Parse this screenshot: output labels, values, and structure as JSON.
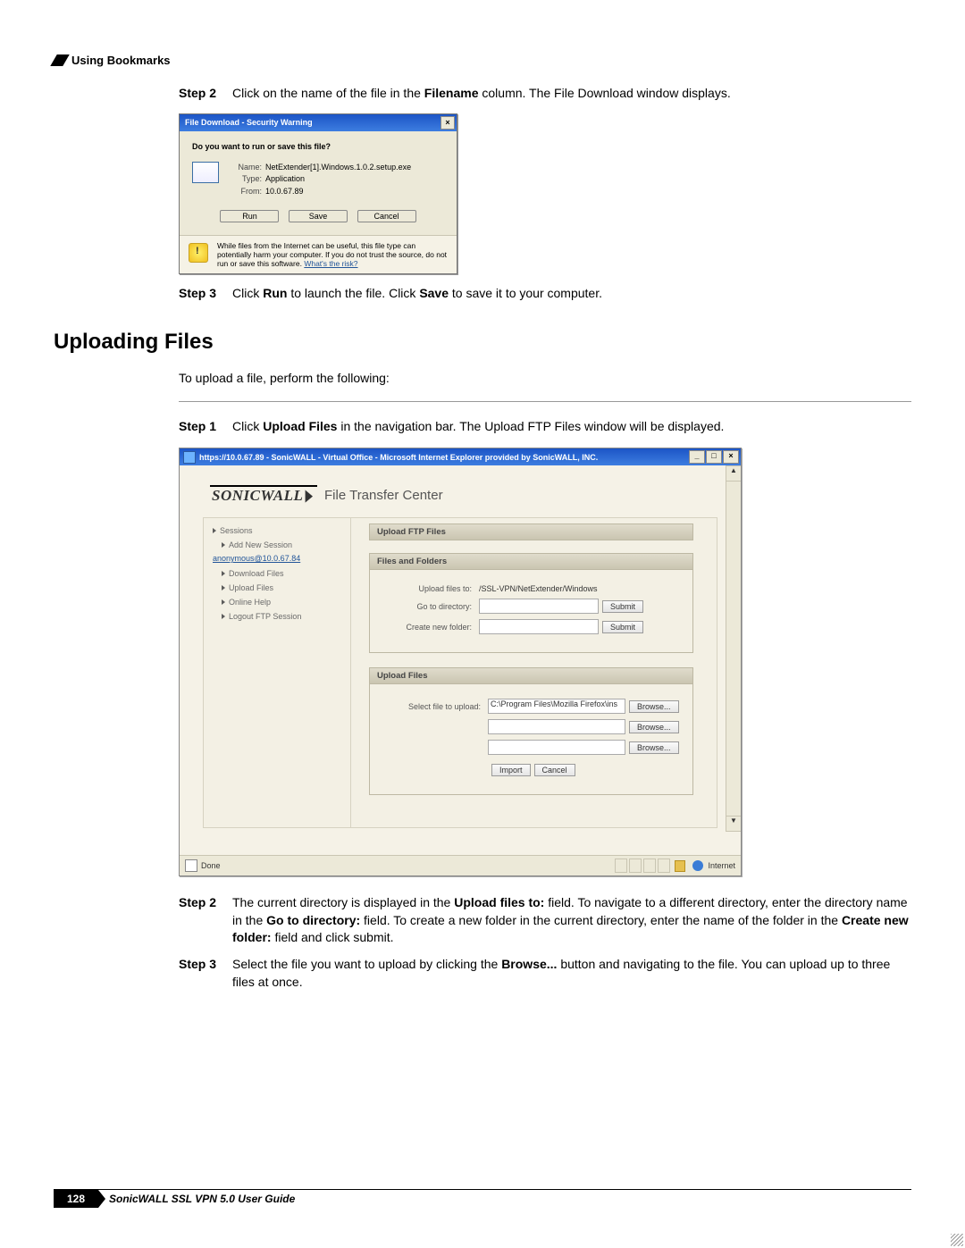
{
  "header": "Using Bookmarks",
  "step2": {
    "label": "Step 2",
    "pre": "Click on the name of the file in the ",
    "bold": "Filename",
    "post": " column. The File Download window displays."
  },
  "dialog1": {
    "title": "File Download - Security Warning",
    "question": "Do you want to run or save this file?",
    "name_label": "Name:",
    "name_value": "NetExtender[1].Windows.1.0.2.setup.exe",
    "type_label": "Type:",
    "type_value": "Application",
    "from_label": "From:",
    "from_value": "10.0.67.89",
    "run": "Run",
    "save": "Save",
    "cancel": "Cancel",
    "warn": "While files from the Internet can be useful, this file type can potentially harm your computer. If you do not trust the source, do not run or save this software. ",
    "risk": "What's the risk?"
  },
  "step3": {
    "label": "Step 3",
    "p1": "Click ",
    "b1": "Run",
    "p2": " to launch the file. Click ",
    "b2": "Save",
    "p3": " to save it to your computer."
  },
  "h2": "Uploading Files",
  "intro": "To upload a file, perform the following:",
  "ustep1": {
    "label": "Step 1",
    "p1": "Click ",
    "b1": "Upload Files",
    "p2": " in the navigation bar. The Upload FTP Files window will be displayed."
  },
  "browser": {
    "title": "https://10.0.67.89 - SonicWALL - Virtual Office - Microsoft Internet Explorer provided by SonicWALL, INC.",
    "min": "_",
    "max": "□",
    "close": "×",
    "scroll_up": "▲",
    "scroll_down": "▼",
    "product": "File Transfer Center",
    "side": {
      "sessions": "Sessions",
      "add": "Add New Session",
      "anon": "anonymous@10.0.67.84",
      "dl": "Download Files",
      "ul": "Upload Files",
      "help": "Online Help",
      "logout": "Logout FTP Session"
    },
    "sec_upload": "Upload FTP Files",
    "sec_files": "Files and Folders",
    "upload_to_lbl": "Upload files to:",
    "upload_to_val": "/SSL-VPN/NetExtender/Windows",
    "goto_lbl": "Go to directory:",
    "newfolder_lbl": "Create new folder:",
    "submit": "Submit",
    "sec_uf": "Upload Files",
    "select_lbl": "Select file to upload:",
    "select_val": "C:\\Program Files\\Mozilla Firefox\\ins",
    "browse": "Browse...",
    "import": "Import",
    "cancel": "Cancel",
    "done": "Done",
    "internet": "Internet"
  },
  "ustep2": {
    "label": "Step 2",
    "p1": "The current directory is displayed in the ",
    "b1": "Upload files to:",
    "p2": " field. To navigate to a different directory, enter the directory name in the ",
    "b2": "Go to directory:",
    "p3": " field. To create a new folder in the current directory, enter the name of the folder in the ",
    "b3": "Create new folder:",
    "p4": " field and click submit."
  },
  "ustep3": {
    "label": "Step 3",
    "p1": "Select the file you want to upload by clicking the ",
    "b1": "Browse...",
    "p2": " button and navigating to the file. You can upload up to three files at once."
  },
  "footer": {
    "page": "128",
    "text": "SonicWALL SSL VPN 5.0 User Guide"
  }
}
